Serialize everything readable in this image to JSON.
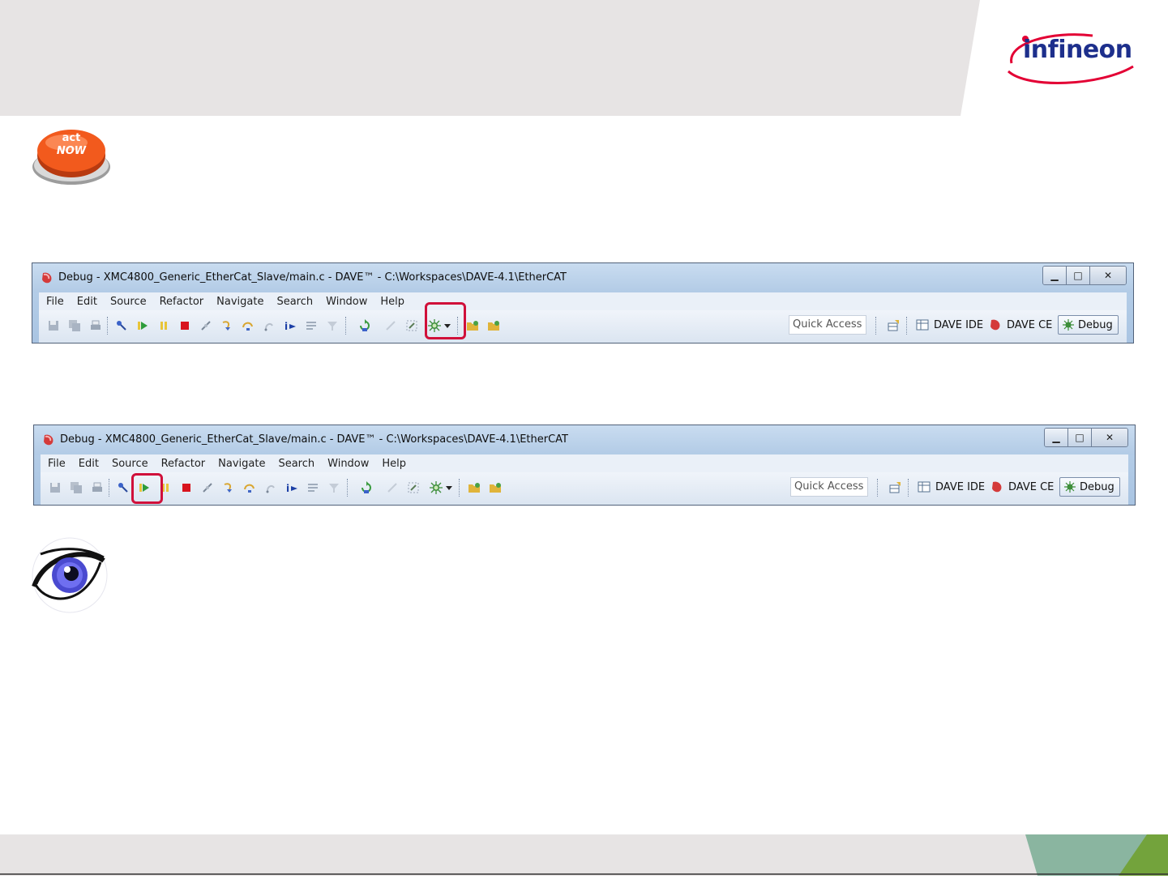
{
  "brand": {
    "name": "infineon"
  },
  "colors": {
    "accent": "#d0103a",
    "brand_blue": "#1d2f8c",
    "brand_red": "#e30034",
    "band_gray": "#e7e4e4",
    "footer_green": "#8ab5a0"
  },
  "icons": {
    "act_now": "act-now-button-icon",
    "eye": "eye-icon"
  },
  "act_now": {
    "line1": "act",
    "line2": "NOW"
  },
  "windows": [
    {
      "title": "Debug - XMC4800_Generic_EtherCat_Slave/main.c - DAVE™ - C:\\Workspaces\\DAVE-4.1\\EtherCAT",
      "menu": [
        "File",
        "Edit",
        "Source",
        "Refactor",
        "Navigate",
        "Search",
        "Window",
        "Help"
      ],
      "quick_access": "Quick Access",
      "perspectives": [
        "DAVE IDE",
        "DAVE CE",
        "Debug"
      ],
      "highlighted_tool": "debug-button"
    },
    {
      "title": "Debug - XMC4800_Generic_EtherCat_Slave/main.c - DAVE™ - C:\\Workspaces\\DAVE-4.1\\EtherCAT",
      "menu": [
        "File",
        "Edit",
        "Source",
        "Refactor",
        "Navigate",
        "Search",
        "Window",
        "Help"
      ],
      "quick_access": "Quick Access",
      "perspectives": [
        "DAVE IDE",
        "DAVE CE",
        "Debug"
      ],
      "highlighted_tool": "resume-button"
    }
  ]
}
